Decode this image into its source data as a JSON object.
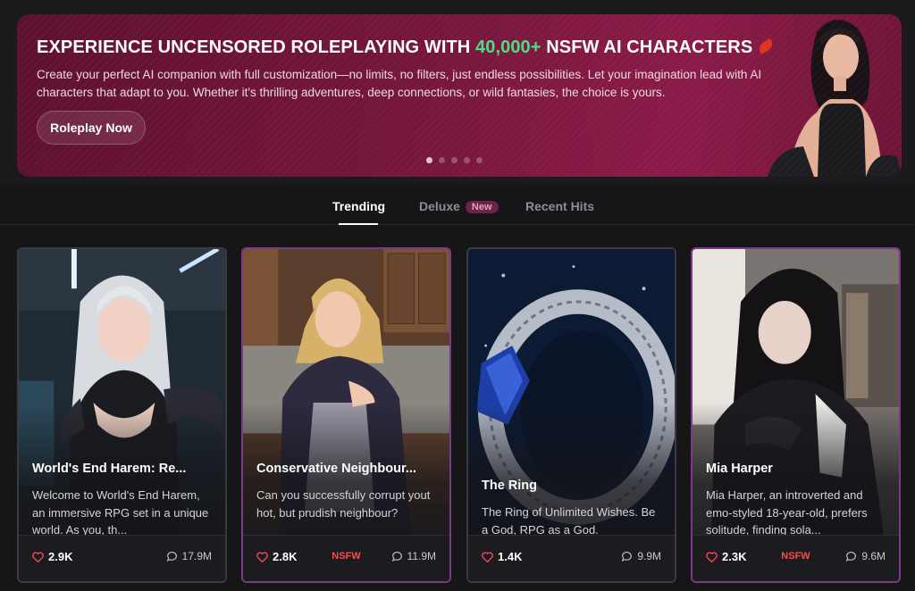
{
  "banner": {
    "title_pre": "EXPERIENCE UNCENSORED ROLEPLAYING WITH ",
    "title_accent": "40,000+",
    "title_post": " NSFW AI CHARACTERS",
    "description": "Create your perfect AI companion with full customization—no limits, no filters, just endless possibilities. Let your imagination lead with AI characters that adapt to you. Whether it's thrilling adventures, deep connections, or wild fantasies, the choice is yours.",
    "cta_label": "Roleplay Now",
    "slide_count": 5,
    "active_slide": 1
  },
  "tabs": [
    {
      "label": "Trending",
      "active": true
    },
    {
      "label": "Deluxe",
      "badge": "New",
      "active": false
    },
    {
      "label": "Recent Hits",
      "active": false
    }
  ],
  "cards": [
    {
      "title": "World's End Harem: Re...",
      "description": "Welcome to World's End Harem, an immersive RPG set in a unique world. As you, th...",
      "likes": "2.9K",
      "views": "17.9M",
      "tag": ""
    },
    {
      "title": "Conservative Neighbour...",
      "description": "Can you successfully corrupt yout hot, but prudish neighbour?",
      "likes": "2.8K",
      "views": "11.9M",
      "tag": "NSFW"
    },
    {
      "title": "The Ring",
      "description": "The Ring of Unlimited Wishes. Be a God, RPG as a God.",
      "likes": "1.4K",
      "views": "9.9M",
      "tag": ""
    },
    {
      "title": "Mia Harper",
      "description": "Mia Harper, an introverted and emo-styled 18-year-old, prefers solitude, finding sola...",
      "likes": "2.3K",
      "views": "9.6M",
      "tag": "NSFW"
    }
  ],
  "colors": {
    "accent_green": "#4ade80",
    "nsfw_red": "#ff4a4a",
    "banner_magenta": "#76163c",
    "card_border_nsfw": "#7a3b86"
  },
  "icons": [
    "heart-icon",
    "comment-icon",
    "chili-icon"
  ]
}
